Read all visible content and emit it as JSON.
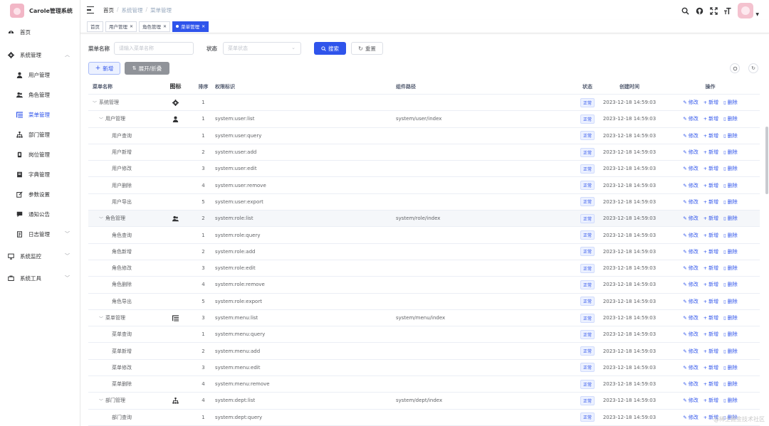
{
  "app": {
    "title": "Carole管理系统"
  },
  "sidebar": {
    "items": [
      {
        "label": "首页",
        "icon": "dashboard-icon",
        "level": "top"
      },
      {
        "label": "系统管理",
        "icon": "gear-icon",
        "level": "top",
        "expanded": true
      },
      {
        "label": "用户管理",
        "icon": "user-icon",
        "level": "sub"
      },
      {
        "label": "角色管理",
        "icon": "people-icon",
        "level": "sub"
      },
      {
        "label": "菜单管理",
        "icon": "tree-table-icon",
        "level": "sub",
        "active": true
      },
      {
        "label": "部门管理",
        "icon": "tree-icon",
        "level": "sub"
      },
      {
        "label": "岗位管理",
        "icon": "post-icon",
        "level": "sub"
      },
      {
        "label": "字典管理",
        "icon": "dict-icon",
        "level": "sub"
      },
      {
        "label": "参数设置",
        "icon": "edit-icon",
        "level": "sub"
      },
      {
        "label": "通知公告",
        "icon": "message-icon",
        "level": "sub"
      },
      {
        "label": "日志管理",
        "icon": "log-icon",
        "level": "sub",
        "collapsed": true
      },
      {
        "label": "系统监控",
        "icon": "monitor-icon",
        "level": "top",
        "collapsed": true
      },
      {
        "label": "系统工具",
        "icon": "tool-icon",
        "level": "top",
        "collapsed": true
      }
    ]
  },
  "breadcrumb": {
    "home": "首页",
    "parent": "系统管理",
    "current": "菜单管理"
  },
  "tags": [
    {
      "label": "首页"
    },
    {
      "label": "用户管理"
    },
    {
      "label": "角色管理"
    },
    {
      "label": "菜单管理",
      "active": true
    }
  ],
  "search": {
    "name_label": "菜单名称",
    "name_placeholder": "请输入菜单名称",
    "status_label": "状态",
    "status_placeholder": "菜单状态",
    "search_btn": "搜索",
    "reset_btn": "重置"
  },
  "toolbar": {
    "add_btn": "新增",
    "expand_btn": "展开/折叠"
  },
  "table": {
    "columns": [
      "菜单名称",
      "图标",
      "排序",
      "权限标识",
      "组件路径",
      "状态",
      "创建时间",
      "操作"
    ],
    "ops": {
      "edit": "修改",
      "add": "新增",
      "delete": "删除"
    },
    "rows": [
      {
        "name": "系统管理",
        "depth": 0,
        "toggle": true,
        "icon": "gear-icon",
        "order": "1",
        "perm": "",
        "component": "",
        "status": "正常",
        "time": "2023-12-18 14:59:03"
      },
      {
        "name": "用户管理",
        "depth": 1,
        "toggle": true,
        "icon": "user-icon",
        "order": "1",
        "perm": "system:user:list",
        "component": "system/user/index",
        "status": "正常",
        "time": "2023-12-18 14:59:03"
      },
      {
        "name": "用户查询",
        "depth": 2,
        "order": "1",
        "perm": "system:user:query",
        "component": "",
        "status": "正常",
        "time": "2023-12-18 14:59:03"
      },
      {
        "name": "用户新增",
        "depth": 2,
        "order": "2",
        "perm": "system:user:add",
        "component": "",
        "status": "正常",
        "time": "2023-12-18 14:59:03"
      },
      {
        "name": "用户修改",
        "depth": 2,
        "order": "3",
        "perm": "system:user:edit",
        "component": "",
        "status": "正常",
        "time": "2023-12-18 14:59:03"
      },
      {
        "name": "用户删除",
        "depth": 2,
        "order": "4",
        "perm": "system:user:remove",
        "component": "",
        "status": "正常",
        "time": "2023-12-18 14:59:03"
      },
      {
        "name": "用户导出",
        "depth": 2,
        "order": "5",
        "perm": "system:user:export",
        "component": "",
        "status": "正常",
        "time": "2023-12-18 14:59:03"
      },
      {
        "name": "角色管理",
        "depth": 1,
        "toggle": true,
        "icon": "people-icon",
        "order": "2",
        "perm": "system:role:list",
        "component": "system/role/index",
        "status": "正常",
        "time": "2023-12-18 14:59:03",
        "highlight": true
      },
      {
        "name": "角色查询",
        "depth": 2,
        "order": "1",
        "perm": "system:role:query",
        "component": "",
        "status": "正常",
        "time": "2023-12-18 14:59:03"
      },
      {
        "name": "角色新增",
        "depth": 2,
        "order": "2",
        "perm": "system:role:add",
        "component": "",
        "status": "正常",
        "time": "2023-12-18 14:59:03"
      },
      {
        "name": "角色修改",
        "depth": 2,
        "order": "3",
        "perm": "system:role:edit",
        "component": "",
        "status": "正常",
        "time": "2023-12-18 14:59:03"
      },
      {
        "name": "角色删除",
        "depth": 2,
        "order": "4",
        "perm": "system:role:remove",
        "component": "",
        "status": "正常",
        "time": "2023-12-18 14:59:03"
      },
      {
        "name": "角色导出",
        "depth": 2,
        "order": "5",
        "perm": "system:role:export",
        "component": "",
        "status": "正常",
        "time": "2023-12-18 14:59:03"
      },
      {
        "name": "菜单管理",
        "depth": 1,
        "toggle": true,
        "icon": "tree-table-icon",
        "order": "3",
        "perm": "system:menu:list",
        "component": "system/menu/index",
        "status": "正常",
        "time": "2023-12-18 14:59:03"
      },
      {
        "name": "菜单查询",
        "depth": 2,
        "order": "1",
        "perm": "system:menu:query",
        "component": "",
        "status": "正常",
        "time": "2023-12-18 14:59:03"
      },
      {
        "name": "菜单新增",
        "depth": 2,
        "order": "2",
        "perm": "system:menu:add",
        "component": "",
        "status": "正常",
        "time": "2023-12-18 14:59:03"
      },
      {
        "name": "菜单修改",
        "depth": 2,
        "order": "3",
        "perm": "system:menu:edit",
        "component": "",
        "status": "正常",
        "time": "2023-12-18 14:59:03"
      },
      {
        "name": "菜单删除",
        "depth": 2,
        "order": "4",
        "perm": "system:menu:remove",
        "component": "",
        "status": "正常",
        "time": "2023-12-18 14:59:03"
      },
      {
        "name": "部门管理",
        "depth": 1,
        "toggle": true,
        "icon": "tree-icon",
        "order": "4",
        "perm": "system:dept:list",
        "component": "system/dept/index",
        "status": "正常",
        "time": "2023-12-18 14:59:03"
      },
      {
        "name": "部门查询",
        "depth": 2,
        "order": "1",
        "perm": "system:dept:query",
        "component": "",
        "status": "正常",
        "time": "2023-12-18 14:59:03"
      }
    ]
  },
  "watermark": "@稀土掘金技术社区",
  "colors": {
    "primary": "#2f54eb",
    "border": "#ebeef5",
    "highlight_row": "#f5f7fa"
  }
}
